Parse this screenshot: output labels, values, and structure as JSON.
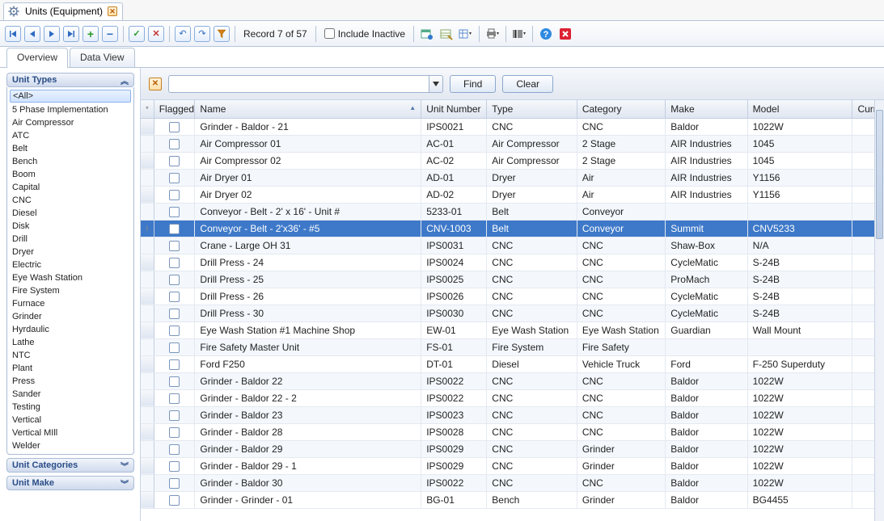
{
  "window": {
    "title": "Units (Equipment)"
  },
  "toolbar": {
    "record_label": "Record 7 of 57",
    "include_inactive": "Include Inactive"
  },
  "tabs": {
    "overview": "Overview",
    "data_view": "Data View"
  },
  "sidebar": {
    "unit_types_hdr": "Unit Types",
    "unit_categories_hdr": "Unit Categories",
    "unit_make_hdr": "Unit Make",
    "types": [
      "<All>",
      "5 Phase Implementation",
      "Air Compressor",
      "ATC",
      "Belt",
      "Bench",
      "Boom",
      "Capital",
      "CNC",
      "Diesel",
      "Disk",
      "Drill",
      "Dryer",
      "Electric",
      "Eye Wash Station",
      "Fire System",
      "Furnace",
      "Grinder",
      "Hyrdaulic",
      "Lathe",
      "NTC",
      "Plant",
      "Press",
      "Sander",
      "Testing",
      "Vertical",
      "Vertical MIll",
      "Welder"
    ]
  },
  "search": {
    "find": "Find",
    "clear": "Clear",
    "value": ""
  },
  "columns": {
    "flagged": "Flagged",
    "name": "Name",
    "unit_number": "Unit Number",
    "type": "Type",
    "category": "Category",
    "make": "Make",
    "model": "Model",
    "current": "Curre"
  },
  "rows": [
    {
      "name": "  Grinder - Baldor - 21",
      "unit_no": "IPS0021",
      "type": "CNC",
      "category": "CNC",
      "make": "Baldor",
      "model": "1022W"
    },
    {
      "name": "Air Compressor 01",
      "unit_no": "AC-01",
      "type": "Air Compressor",
      "category": "2 Stage",
      "make": "AIR Industries",
      "model": "1045"
    },
    {
      "name": "Air Compressor 02",
      "unit_no": "AC-02",
      "type": "Air Compressor",
      "category": "2 Stage",
      "make": "AIR Industries",
      "model": "1045"
    },
    {
      "name": "Air Dryer 01",
      "unit_no": "AD-01",
      "type": "Dryer",
      "category": "Air",
      "make": "AIR Industries",
      "model": "Y1156"
    },
    {
      "name": "Air Dryer 02",
      "unit_no": "AD-02",
      "type": "Dryer",
      "category": "Air",
      "make": "AIR Industries",
      "model": "Y1156"
    },
    {
      "name": "Conveyor - Belt - 2' x 16' - Unit #",
      "unit_no": "5233-01",
      "type": "Belt",
      "category": "Conveyor",
      "make": "",
      "model": ""
    },
    {
      "name": "Conveyor - Belt - 2'x36' - #5",
      "unit_no": "CNV-1003",
      "type": "Belt",
      "category": "Conveyor",
      "make": "Summit",
      "model": "CNV5233",
      "selected": true
    },
    {
      "name": "Crane - Large OH 31",
      "unit_no": "IPS0031",
      "type": "CNC",
      "category": "CNC",
      "make": "Shaw-Box",
      "model": "N/A"
    },
    {
      "name": "Drill Press - 24",
      "unit_no": "IPS0024",
      "type": "CNC",
      "category": "CNC",
      "make": "CycleMatic",
      "model": "S-24B"
    },
    {
      "name": "Drill Press - 25",
      "unit_no": "IPS0025",
      "type": "CNC",
      "category": "CNC",
      "make": "ProMach",
      "model": "S-24B"
    },
    {
      "name": "Drill Press - 26",
      "unit_no": "IPS0026",
      "type": "CNC",
      "category": "CNC",
      "make": "CycleMatic",
      "model": "S-24B"
    },
    {
      "name": "Drill Press - 30",
      "unit_no": "IPS0030",
      "type": "CNC",
      "category": "CNC",
      "make": "CycleMatic",
      "model": "S-24B"
    },
    {
      "name": "Eye Wash Station #1 Machine Shop",
      "unit_no": "EW-01",
      "type": "Eye Wash Station",
      "category": "Eye Wash Station",
      "make": "Guardian",
      "model": "Wall Mount"
    },
    {
      "name": "Fire Safety Master Unit",
      "unit_no": "FS-01",
      "type": "Fire System",
      "category": "Fire Safety",
      "make": "",
      "model": ""
    },
    {
      "name": "Ford F250",
      "unit_no": "DT-01",
      "type": "Diesel",
      "category": "Vehicle Truck",
      "make": "Ford",
      "model": "F-250 Superduty"
    },
    {
      "name": "Grinder - Baldor 22",
      "unit_no": "IPS0022",
      "type": "CNC",
      "category": "CNC",
      "make": "Baldor",
      "model": "1022W"
    },
    {
      "name": "Grinder - Baldor 22 - 2",
      "unit_no": "IPS0022",
      "type": "CNC",
      "category": "CNC",
      "make": "Baldor",
      "model": "1022W"
    },
    {
      "name": "Grinder - Baldor 23",
      "unit_no": "IPS0023",
      "type": "CNC",
      "category": "CNC",
      "make": "Baldor",
      "model": "1022W"
    },
    {
      "name": "Grinder - Baldor 28",
      "unit_no": "IPS0028",
      "type": "CNC",
      "category": "CNC",
      "make": "Baldor",
      "model": "1022W"
    },
    {
      "name": "Grinder - Baldor 29",
      "unit_no": "IPS0029",
      "type": "CNC",
      "category": "Grinder",
      "make": "Baldor",
      "model": "1022W"
    },
    {
      "name": "Grinder - Baldor 29 - 1",
      "unit_no": "IPS0029",
      "type": "CNC",
      "category": "Grinder",
      "make": "Baldor",
      "model": "1022W"
    },
    {
      "name": "Grinder - Baldor 30",
      "unit_no": "IPS0022",
      "type": "CNC",
      "category": "CNC",
      "make": "Baldor",
      "model": "1022W"
    },
    {
      "name": "Grinder - Grinder - 01",
      "unit_no": "BG-01",
      "type": "Bench",
      "category": "Grinder",
      "make": "Baldor",
      "model": "BG4455"
    }
  ]
}
